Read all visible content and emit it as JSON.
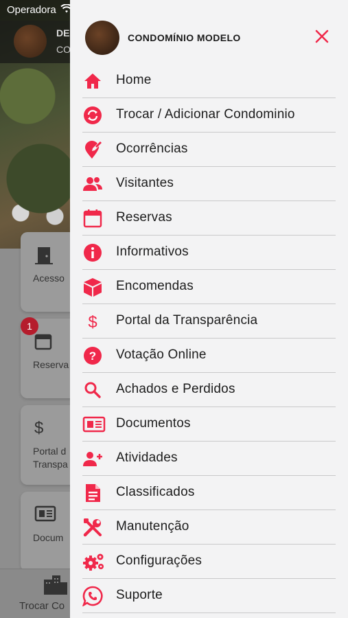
{
  "status_bar": {
    "carrier": "Operadora"
  },
  "background": {
    "header_title": "DE",
    "header_subtitle": "CO",
    "cards": [
      {
        "label": "Acesso",
        "icon": "door-icon"
      },
      {
        "label": "Reserva",
        "icon": "calendar-icon",
        "badge": "1"
      },
      {
        "label": "Portal d Transpa",
        "icon": "dollar-icon"
      },
      {
        "label": "Docum",
        "icon": "newspaper-icon"
      }
    ],
    "tabbar_label": "Trocar Co"
  },
  "drawer": {
    "title": "CONDOMÍNIO MODELO",
    "accent_color": "#f0284a",
    "items": [
      {
        "label": "Home",
        "icon": "home-icon"
      },
      {
        "label": "Trocar / Adicionar Condominio",
        "icon": "sync-icon"
      },
      {
        "label": "Ocorrências",
        "icon": "map-pin-edit-icon"
      },
      {
        "label": "Visitantes",
        "icon": "users-icon"
      },
      {
        "label": "Reservas",
        "icon": "calendar-icon"
      },
      {
        "label": "Informativos",
        "icon": "info-icon"
      },
      {
        "label": "Encomendas",
        "icon": "package-icon"
      },
      {
        "label": "Portal da Transparência",
        "icon": "dollar-icon"
      },
      {
        "label": "Votação Online",
        "icon": "question-icon"
      },
      {
        "label": "Achados e Perdidos",
        "icon": "search-icon"
      },
      {
        "label": "Documentos",
        "icon": "newspaper-icon"
      },
      {
        "label": "Atividades",
        "icon": "user-plus-icon"
      },
      {
        "label": "Classificados",
        "icon": "document-icon"
      },
      {
        "label": "Manutenção",
        "icon": "tools-icon"
      },
      {
        "label": "Configurações",
        "icon": "gears-icon"
      },
      {
        "label": "Suporte",
        "icon": "whatsapp-icon"
      }
    ]
  }
}
